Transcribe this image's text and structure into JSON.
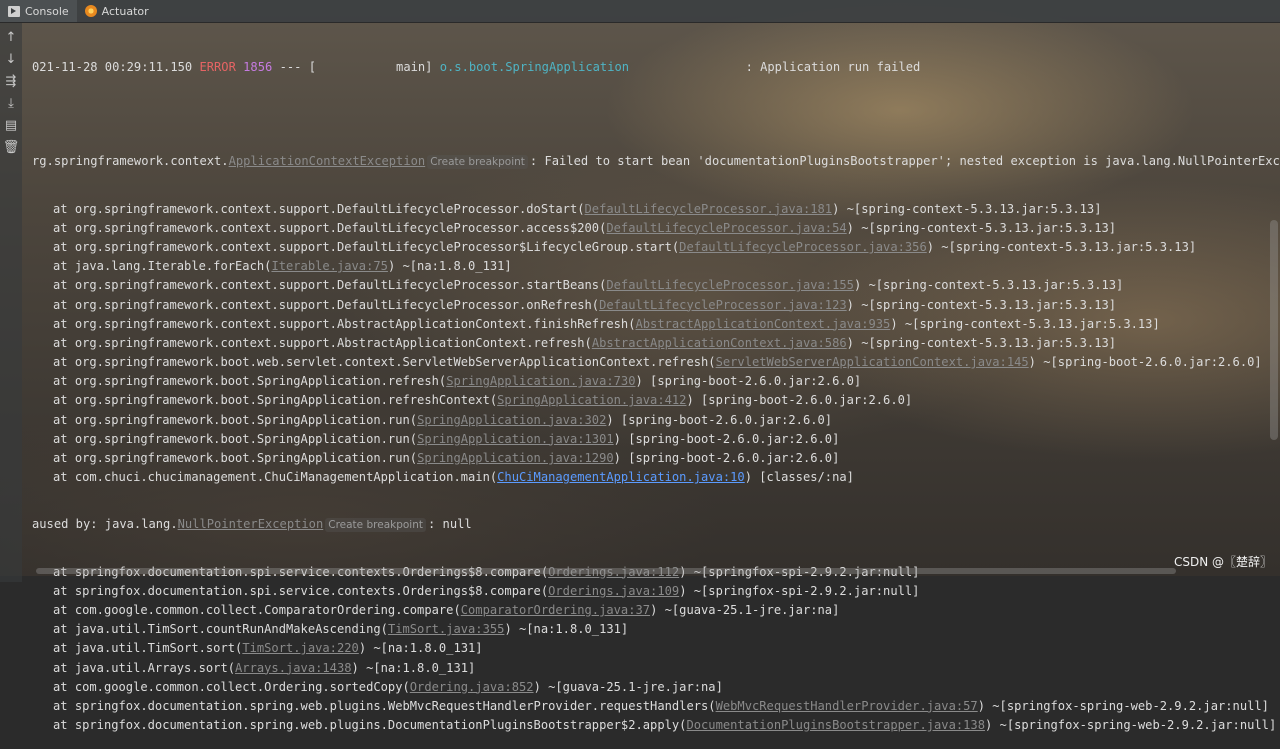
{
  "tabs": [
    {
      "label": "Console",
      "icon": "console-icon"
    },
    {
      "label": "Actuator",
      "icon": "actuator-icon"
    }
  ],
  "gutter": {
    "buttons": [
      "up-arrow-icon",
      "down-arrow-icon",
      "soft-wrap-icon",
      "scroll-to-end-icon",
      "print-icon",
      "trash-icon"
    ],
    "glyphs": [
      "↑",
      "↓",
      "⇶",
      "⤓",
      "▤",
      "🗑"
    ]
  },
  "log": {
    "header": {
      "timestamp": "021-11-28 00:29:11.150",
      "level": "ERROR",
      "pid": "1856",
      "sep": "---",
      "thread": "[           main]",
      "logger": "o.s.boot.SpringApplication",
      "message": ": Application run failed"
    },
    "exception": {
      "prefix": "rg.springframework.context.",
      "class": "ApplicationContextException",
      "hint": "Create breakpoint",
      "message": ": Failed to start bean 'documentationPluginsBootstrapper'; nested exception is java.lang.NullPointerException"
    },
    "frames1": [
      {
        "pre": "at org.springframework.context.support.DefaultLifecycleProcessor.doStart(",
        "link": "DefaultLifecycleProcessor.java:181",
        "post": ") ~[spring-context-5.3.13.jar:5.3.13]"
      },
      {
        "pre": "at org.springframework.context.support.DefaultLifecycleProcessor.access$200(",
        "link": "DefaultLifecycleProcessor.java:54",
        "post": ") ~[spring-context-5.3.13.jar:5.3.13]"
      },
      {
        "pre": "at org.springframework.context.support.DefaultLifecycleProcessor$LifecycleGroup.start(",
        "link": "DefaultLifecycleProcessor.java:356",
        "post": ") ~[spring-context-5.3.13.jar:5.3.13]"
      },
      {
        "pre": "at java.lang.Iterable.forEach(",
        "link": "Iterable.java:75",
        "post": ") ~[na:1.8.0_131]"
      },
      {
        "pre": "at org.springframework.context.support.DefaultLifecycleProcessor.startBeans(",
        "link": "DefaultLifecycleProcessor.java:155",
        "post": ") ~[spring-context-5.3.13.jar:5.3.13]"
      },
      {
        "pre": "at org.springframework.context.support.DefaultLifecycleProcessor.onRefresh(",
        "link": "DefaultLifecycleProcessor.java:123",
        "post": ") ~[spring-context-5.3.13.jar:5.3.13]"
      },
      {
        "pre": "at org.springframework.context.support.AbstractApplicationContext.finishRefresh(",
        "link": "AbstractApplicationContext.java:935",
        "post": ") ~[spring-context-5.3.13.jar:5.3.13]"
      },
      {
        "pre": "at org.springframework.context.support.AbstractApplicationContext.refresh(",
        "link": "AbstractApplicationContext.java:586",
        "post": ") ~[spring-context-5.3.13.jar:5.3.13]"
      },
      {
        "pre": "at org.springframework.boot.web.servlet.context.ServletWebServerApplicationContext.refresh(",
        "link": "ServletWebServerApplicationContext.java:145",
        "post": ") ~[spring-boot-2.6.0.jar:2.6.0]"
      },
      {
        "pre": "at org.springframework.boot.SpringApplication.refresh(",
        "link": "SpringApplication.java:730",
        "post": ") [spring-boot-2.6.0.jar:2.6.0]"
      },
      {
        "pre": "at org.springframework.boot.SpringApplication.refreshContext(",
        "link": "SpringApplication.java:412",
        "post": ") [spring-boot-2.6.0.jar:2.6.0]"
      },
      {
        "pre": "at org.springframework.boot.SpringApplication.run(",
        "link": "SpringApplication.java:302",
        "post": ") [spring-boot-2.6.0.jar:2.6.0]"
      },
      {
        "pre": "at org.springframework.boot.SpringApplication.run(",
        "link": "SpringApplication.java:1301",
        "post": ") [spring-boot-2.6.0.jar:2.6.0]"
      },
      {
        "pre": "at org.springframework.boot.SpringApplication.run(",
        "link": "SpringApplication.java:1290",
        "post": ") [spring-boot-2.6.0.jar:2.6.0]"
      },
      {
        "pre": "at com.chuci.chucimanagement.ChuCiManagementApplication.main(",
        "link": "ChuCiManagementApplication.java:10",
        "post": ") [classes/:na]",
        "active": true
      }
    ],
    "caused_by": {
      "prefix": "aused by: java.lang.",
      "class": "NullPointerException",
      "hint": "Create breakpoint",
      "message": ": null"
    },
    "frames2": [
      {
        "pre": "at springfox.documentation.spi.service.contexts.Orderings$8.compare(",
        "link": "Orderings.java:112",
        "post": ") ~[springfox-spi-2.9.2.jar:null]"
      },
      {
        "pre": "at springfox.documentation.spi.service.contexts.Orderings$8.compare(",
        "link": "Orderings.java:109",
        "post": ") ~[springfox-spi-2.9.2.jar:null]"
      },
      {
        "pre": "at com.google.common.collect.ComparatorOrdering.compare(",
        "link": "ComparatorOrdering.java:37",
        "post": ") ~[guava-25.1-jre.jar:na]"
      },
      {
        "pre": "at java.util.TimSort.countRunAndMakeAscending(",
        "link": "TimSort.java:355",
        "post": ") ~[na:1.8.0_131]"
      },
      {
        "pre": "at java.util.TimSort.sort(",
        "link": "TimSort.java:220",
        "post": ") ~[na:1.8.0_131]"
      },
      {
        "pre": "at java.util.Arrays.sort(",
        "link": "Arrays.java:1438",
        "post": ") ~[na:1.8.0_131]"
      },
      {
        "pre": "at com.google.common.collect.Ordering.sortedCopy(",
        "link": "Ordering.java:852",
        "post": ") ~[guava-25.1-jre.jar:na]"
      },
      {
        "pre": "at springfox.documentation.spring.web.plugins.WebMvcRequestHandlerProvider.requestHandlers(",
        "link": "WebMvcRequestHandlerProvider.java:57",
        "post": ") ~[springfox-spring-web-2.9.2.jar:null]"
      },
      {
        "pre": "at springfox.documentation.spring.web.plugins.DocumentationPluginsBootstrapper$2.apply(",
        "link": "DocumentationPluginsBootstrapper.java:138",
        "post": ") ~[springfox-spring-web-2.9.2.jar:null]"
      }
    ]
  },
  "watermark": "CSDN @〖楚辞〗"
}
